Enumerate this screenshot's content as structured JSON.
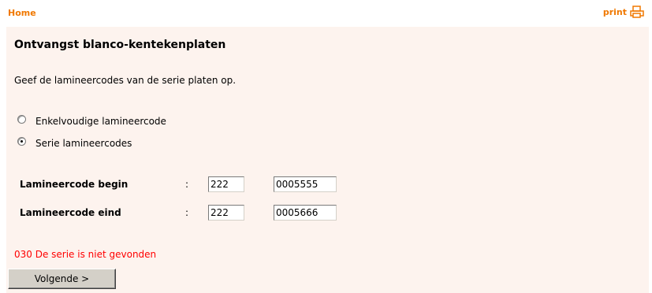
{
  "nav": {
    "home_label": "Home",
    "print_label": "print",
    "print_icon": "printer-icon",
    "accent_color": "#f07800"
  },
  "form": {
    "title": "Ontvangst blanco-kentekenplaten",
    "instruction": "Geef de lamineercodes van de serie platen op.",
    "options": [
      {
        "label": "Enkelvoudige lamineercode",
        "selected": false
      },
      {
        "label": "Serie lamineercodes",
        "selected": true
      }
    ],
    "fields": [
      {
        "label": "Lamineercode begin",
        "separator": ":",
        "code_a": "222",
        "code_b": "0005555"
      },
      {
        "label": "Lamineercode eind",
        "separator": ":",
        "code_a": "222",
        "code_b": "0005666"
      }
    ],
    "error_message": "030 De serie is niet gevonden",
    "error_color": "#ff0000",
    "next_button": "Volgende >"
  }
}
